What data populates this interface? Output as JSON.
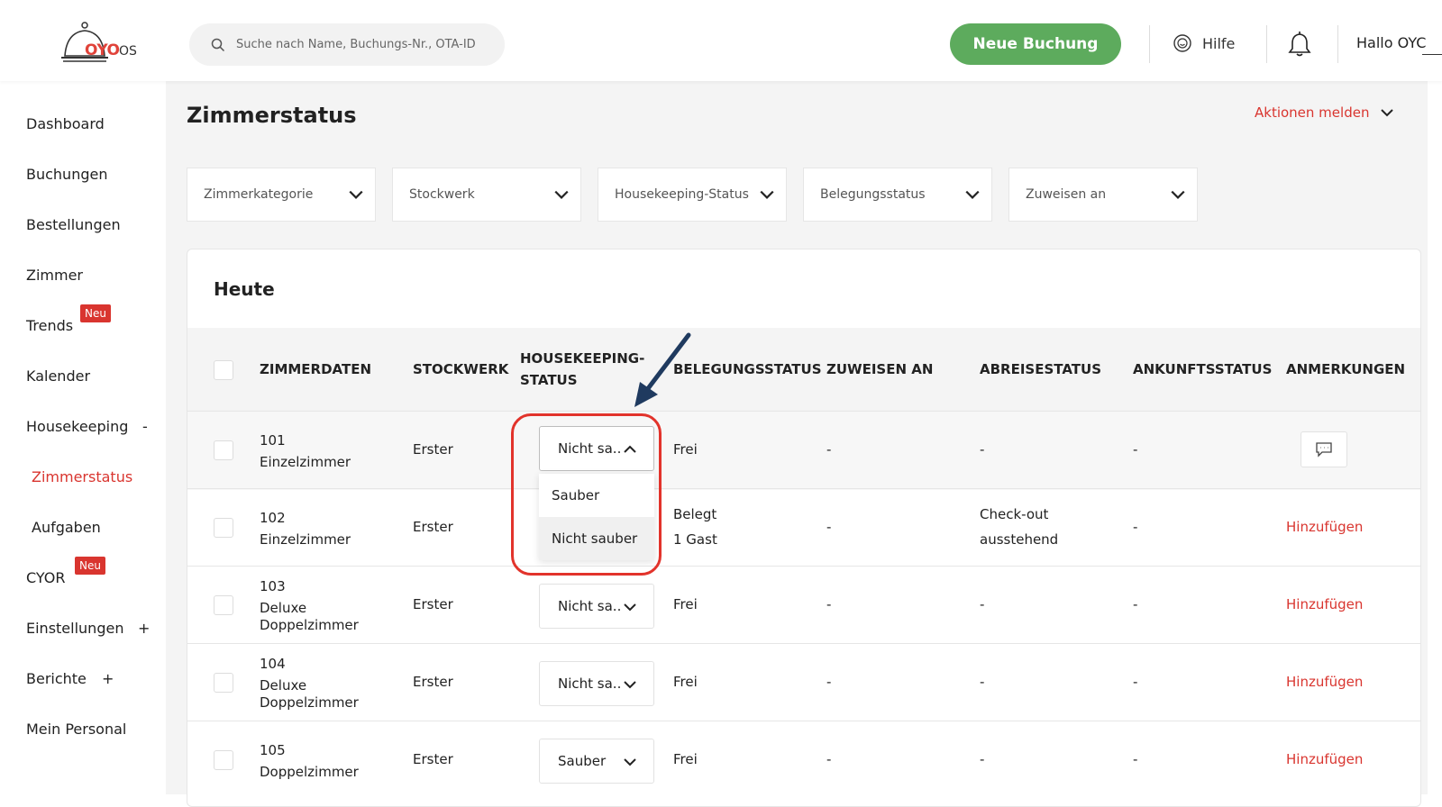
{
  "header": {
    "logo_text": "OYO",
    "logo_suffix": "OS",
    "search_placeholder": "Suche nach Name, Buchungs-Nr., OTA-ID",
    "new_booking_label": "Neue Buchung",
    "help_label": "Hilfe",
    "greeting": "Hallo OYC"
  },
  "sidebar": {
    "items": [
      {
        "label": "Dashboard"
      },
      {
        "label": "Buchungen"
      },
      {
        "label": "Bestellungen"
      },
      {
        "label": "Zimmer"
      },
      {
        "label": "Trends",
        "badge": "Neu"
      },
      {
        "label": "Kalender"
      },
      {
        "label": "Housekeeping",
        "sign": "-"
      },
      {
        "label": "Zimmerstatus",
        "active": true
      },
      {
        "label": "Aufgaben"
      },
      {
        "label": "CYOR",
        "badge": "Neu"
      },
      {
        "label": "Einstellungen",
        "sign": "+"
      },
      {
        "label": "Berichte",
        "sign": "+"
      },
      {
        "label": "Mein Personal"
      }
    ]
  },
  "page": {
    "title": "Zimmerstatus",
    "report_label": "Aktionen melden",
    "filters": [
      "Zimmerkategorie",
      "Stockwerk",
      "Housekeeping-Status",
      "Belegungsstatus",
      "Zuweisen an"
    ],
    "section_title": "Heute"
  },
  "table": {
    "headers": {
      "room": "ZIMMERDATEN",
      "floor": "STOCKWERK",
      "hk_1": "HOUSEKEEPING-",
      "hk_2": "STATUS",
      "occupancy": "BELEGUNGSSTATUS",
      "assign": "ZUWEISEN AN",
      "departure": "ABREISESTATUS",
      "arrival": "ANKUNFTSSTATUS",
      "notes": "ANMERKUNGEN"
    },
    "rows": [
      {
        "number": "101",
        "type_1": "Einzelzimmer",
        "type_2": "",
        "floor": "Erster",
        "hk": "Nicht sa..",
        "occ_1": "Frei",
        "occ_2": "",
        "assign": "-",
        "dep_1": "-",
        "dep_2": "",
        "arr": "-",
        "notes": ""
      },
      {
        "number": "102",
        "type_1": "Einzelzimmer",
        "type_2": "",
        "floor": "Erster",
        "hk": "",
        "occ_1": "Belegt",
        "occ_2": "1 Gast",
        "assign": "-",
        "dep_1": "Check-out",
        "dep_2": "ausstehend",
        "arr": "-",
        "notes": "Hinzufügen"
      },
      {
        "number": "103",
        "type_1": "Deluxe",
        "type_2": "Doppelzimmer",
        "floor": "Erster",
        "hk": "Nicht sa..",
        "occ_1": "Frei",
        "occ_2": "",
        "assign": "-",
        "dep_1": "-",
        "dep_2": "",
        "arr": "-",
        "notes": "Hinzufügen"
      },
      {
        "number": "104",
        "type_1": "Deluxe",
        "type_2": "Doppelzimmer",
        "floor": "Erster",
        "hk": "Nicht sa..",
        "occ_1": "Frei",
        "occ_2": "",
        "assign": "-",
        "dep_1": "-",
        "dep_2": "",
        "arr": "-",
        "notes": "Hinzufügen"
      },
      {
        "number": "105",
        "type_1": "Doppelzimmer",
        "type_2": "",
        "floor": "Erster",
        "hk": "Sauber",
        "occ_1": "Frei",
        "occ_2": "",
        "assign": "-",
        "dep_1": "-",
        "dep_2": "",
        "arr": "-",
        "notes": "Hinzufügen"
      }
    ],
    "dropdown_options": [
      "Sauber",
      "Nicht sauber"
    ]
  },
  "colors": {
    "brand_red": "#d9352f",
    "button_green": "#5dab5d",
    "annotation_red": "#e2332b",
    "annotation_arrow": "#1f3a5f"
  }
}
